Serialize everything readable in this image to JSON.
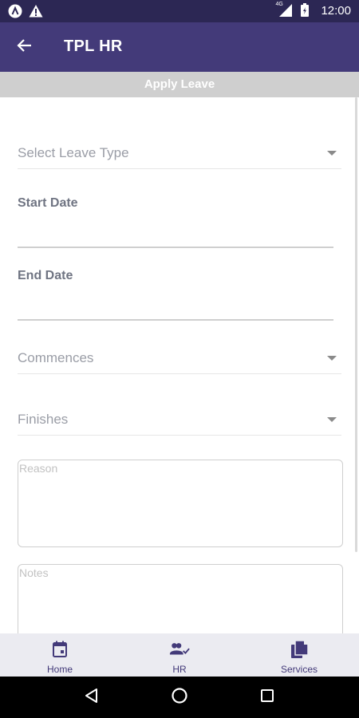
{
  "status_bar": {
    "time": "12:00",
    "network": "4G",
    "icons": [
      "app-a-icon",
      "warning-icon",
      "signal-icon",
      "battery-icon"
    ]
  },
  "app_bar": {
    "title": "TPL HR",
    "back_icon": "arrow-left-icon",
    "color": "#433a79"
  },
  "subheader": {
    "title": "Apply Leave"
  },
  "form": {
    "leave_type_placeholder": "Select Leave Type",
    "start_date_label": "Start Date",
    "end_date_label": "End Date",
    "commences_placeholder": "Commences",
    "finishes_placeholder": "Finishes",
    "reason_placeholder": "Reason",
    "notes_placeholder": "Notes"
  },
  "bottom_nav": {
    "items": [
      {
        "label": "Home",
        "icon": "calendar-icon"
      },
      {
        "label": "HR",
        "icon": "people-check-icon"
      },
      {
        "label": "Services",
        "icon": "documents-icon"
      }
    ]
  },
  "system_nav": {
    "icons": [
      "back-triangle-icon",
      "home-circle-icon",
      "recents-square-icon"
    ]
  }
}
